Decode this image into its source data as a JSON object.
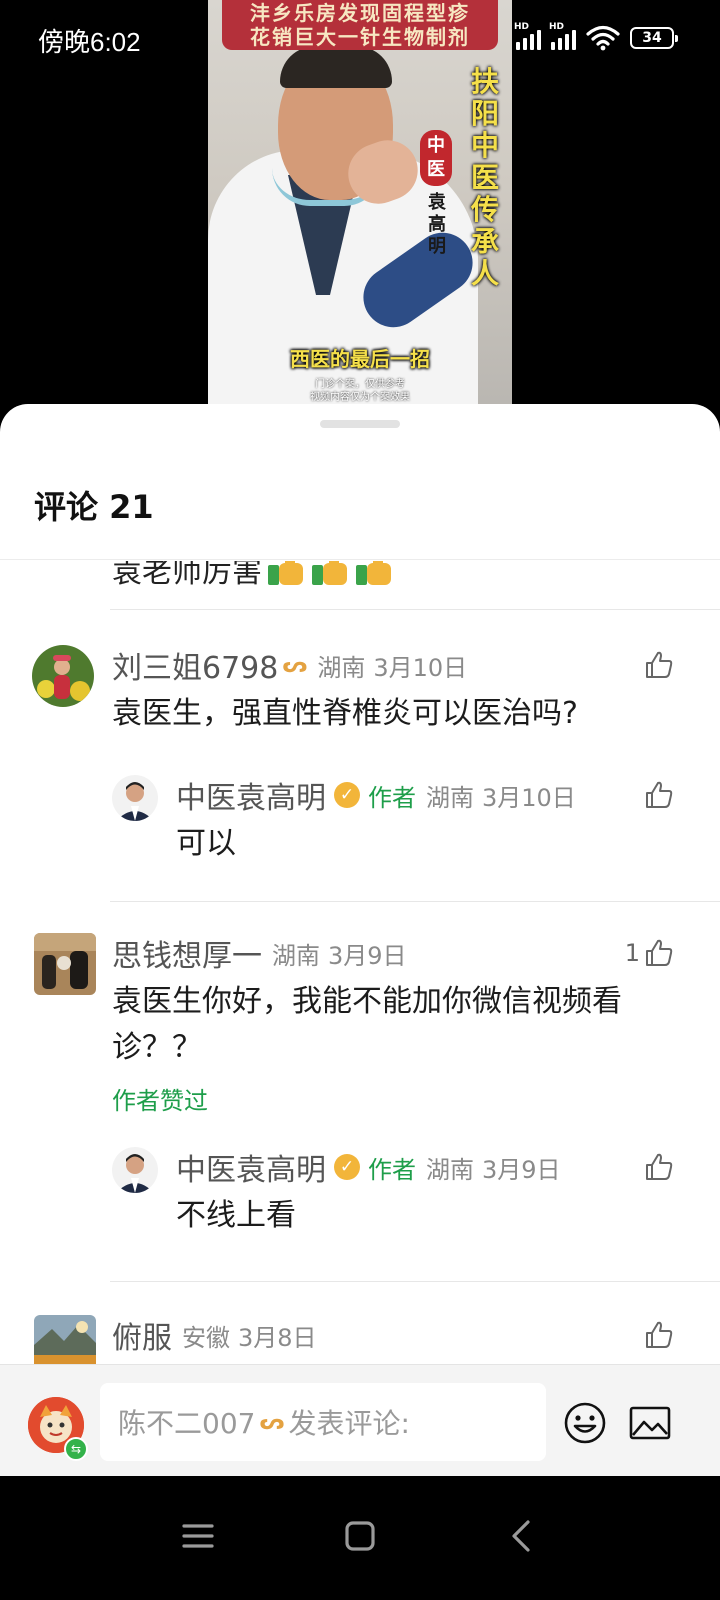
{
  "status_bar": {
    "time": "傍晚6:02",
    "battery": "34",
    "network_label": "HD"
  },
  "video": {
    "banner_line1": "沣乡乐房发现固程型疹",
    "banner_line2": "花销巨大一针生物制剂",
    "vertical_title": "扶阳中医传承人",
    "seal_text": "中医",
    "doctor_name": "袁高明",
    "caption": "西医的最后一招",
    "disclaimer_line1": "门诊个案，仅供参考",
    "disclaimer_line2": "视频内容仅为个案效果"
  },
  "comments_header": {
    "title": "评论 21"
  },
  "partial_comment": {
    "text": "袁老师厉害",
    "emoji_icon": "thumbs-up-emoji"
  },
  "comments": [
    {
      "user": "刘三姐6798",
      "vip_icon": "ᔕ",
      "location": "湖南",
      "date": "3月10日",
      "text": "袁医生，强直性脊椎炎可以医治吗?",
      "likes": "",
      "reply": {
        "user": "中医袁高明",
        "author_tag": "作者",
        "location": "湖南",
        "date": "3月10日",
        "text": "可以"
      }
    },
    {
      "user": "思钱想厚一",
      "location": "湖南",
      "date": "3月9日",
      "text_line1": "袁医生你好，我能不能加你微信视频看",
      "text_line2": "诊？？",
      "likes": "1",
      "author_liked": "作者赞过",
      "reply": {
        "user": "中医袁高明",
        "author_tag": "作者",
        "location": "湖南",
        "date": "3月9日",
        "text": "不线上看"
      }
    },
    {
      "user": "俯服",
      "location": "安徽",
      "date": "3月8日",
      "likes": ""
    }
  ],
  "input_bar": {
    "username": "陈不二007",
    "vip_icon": "ᔕ",
    "placeholder": "发表评论:",
    "avatar_badge": "⇆"
  },
  "colors": {
    "author_green": "#1e9e4a",
    "vip_gold": "#e4a241",
    "banner_red": "#b4303a",
    "caption_yellow": "#f5e04a"
  }
}
